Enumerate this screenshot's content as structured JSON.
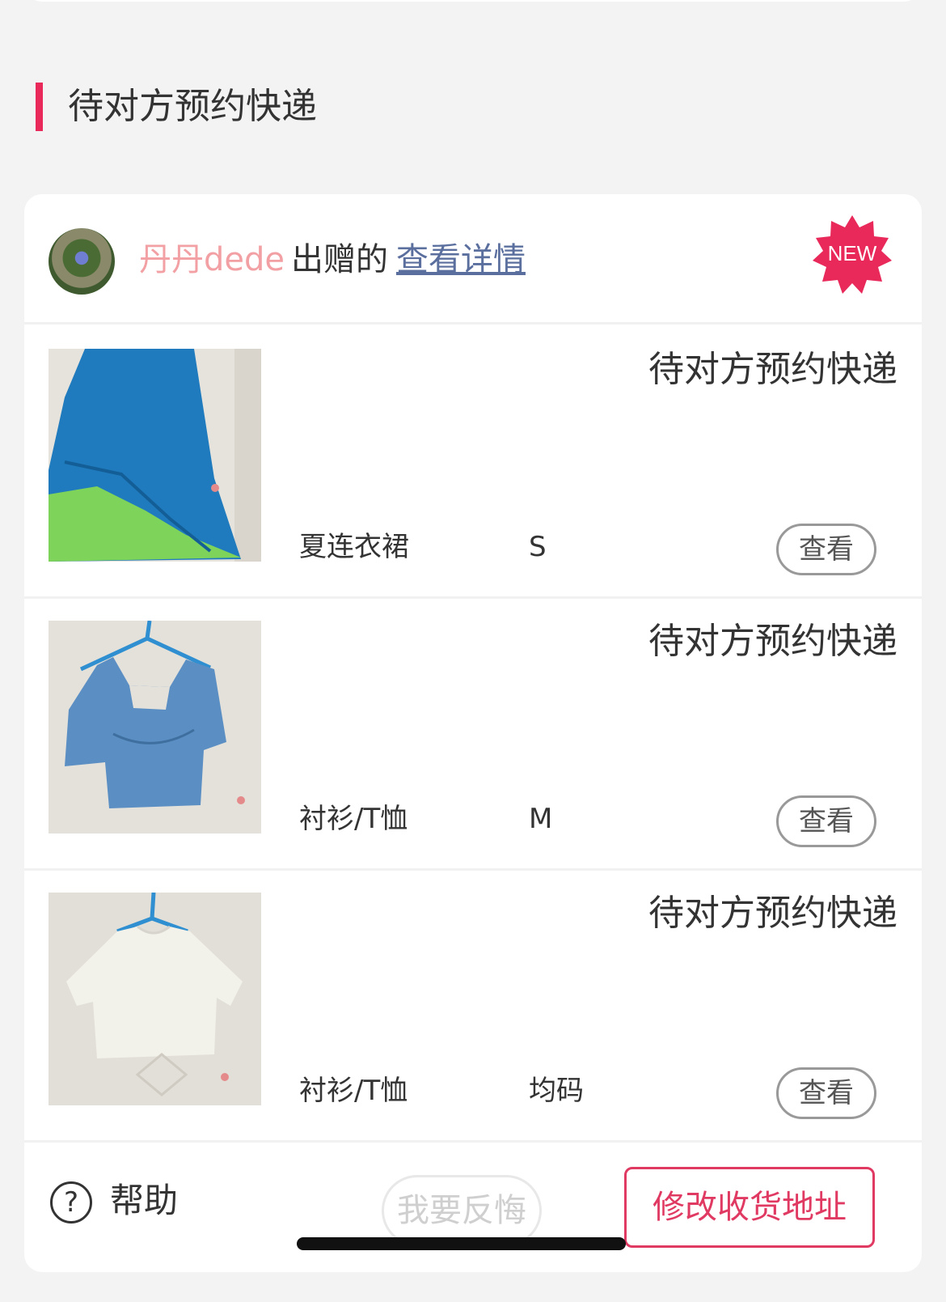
{
  "section": {
    "title": "待对方预约快递"
  },
  "header": {
    "donor_name": "丹丹dede",
    "donor_suffix": "出赠的",
    "details_link": "查看详情",
    "badge": "NEW"
  },
  "items": [
    {
      "status": "待对方预约快递",
      "category": "夏连衣裙",
      "size": "S",
      "view_label": "查看"
    },
    {
      "status": "待对方预约快递",
      "category": "衬衫/T恤",
      "size": "M",
      "view_label": "查看"
    },
    {
      "status": "待对方预约快递",
      "category": "衬衫/T恤",
      "size": "均码",
      "view_label": "查看"
    }
  ],
  "footer": {
    "help_label": "帮助",
    "regret_label": "我要反悔",
    "edit_address_label": "修改收货地址"
  },
  "colors": {
    "accent": "#e8295a",
    "donor_name": "#f2a0a3",
    "link": "#5a6f9e",
    "button_accent": "#e03a63"
  }
}
